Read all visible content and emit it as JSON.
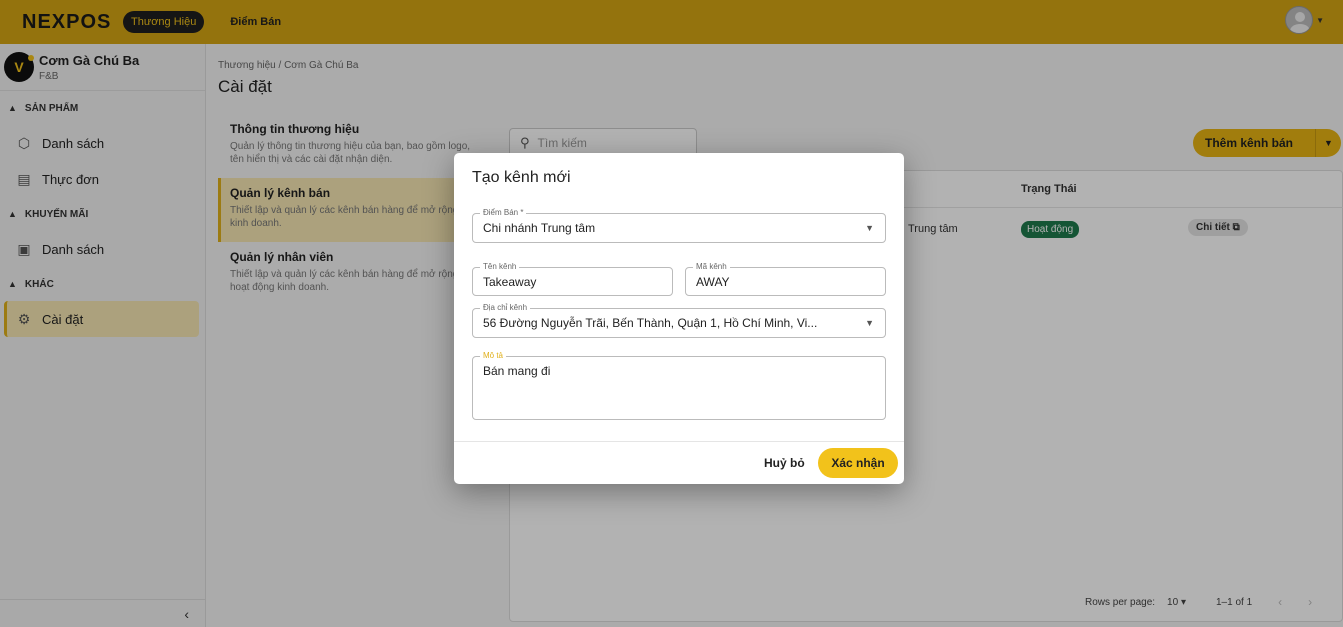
{
  "topbar": {
    "logo": "NEXPOS",
    "tab_brand": "Thương Hiệu",
    "tab_store": "Điểm Bán"
  },
  "sidebar": {
    "brand_name": "Cơm Gà Chú Ba",
    "brand_type": "F&B",
    "sections": [
      {
        "title": "SẢN PHẨM",
        "items": [
          "Danh sách",
          "Thực đơn"
        ]
      },
      {
        "title": "KHUYẾN MÃI",
        "items": [
          "Danh sách"
        ]
      },
      {
        "title": "KHÁC",
        "items": [
          "Cài đặt"
        ]
      }
    ]
  },
  "main": {
    "breadcrumb": "Thương hiệu  /  Cơm Gà Chú Ba",
    "title": "Cài đặt",
    "settings": [
      {
        "title": "Thông tin thương hiệu",
        "desc": "Quản lý thông tin thương hiệu của bạn, bao gồm logo, tên hiển thị và các cài đặt nhận diện."
      },
      {
        "title": "Quản lý kênh bán",
        "desc": "Thiết lập và quản lý các kênh bán hàng để mở rộng kinh doanh."
      },
      {
        "title": "Quản lý nhân viên",
        "desc": "Thiết lập và quản lý các kênh bán hàng để mở rộng hoạt động kinh doanh."
      }
    ],
    "search_placeholder": "Tìm kiếm",
    "add_button": "Thêm kênh bán",
    "table": {
      "status_header": "Trạng Thái",
      "row_store": "Trung tâm",
      "row_status": "Hoạt động",
      "row_action": "Chi tiết"
    },
    "pagination": {
      "rows_label": "Rows per page:",
      "rows_value": "10",
      "range": "1–1 of 1"
    }
  },
  "modal": {
    "title": "Tạo kênh mới",
    "store_label": "Điểm Bán *",
    "store_value": "Chi nhánh Trung tâm",
    "name_label": "Tên kênh",
    "name_value": "Takeaway",
    "code_label": "Mã kênh",
    "code_value": "AWAY",
    "address_label": "Địa chỉ kênh",
    "address_value": "56 Đường Nguyễn Trãi, Bến Thành, Quận 1, Hồ Chí Minh, Vi...",
    "desc_label": "Mô tả",
    "desc_value": "Bán mang đi",
    "cancel": "Huỷ bỏ",
    "confirm": "Xác nhận"
  }
}
